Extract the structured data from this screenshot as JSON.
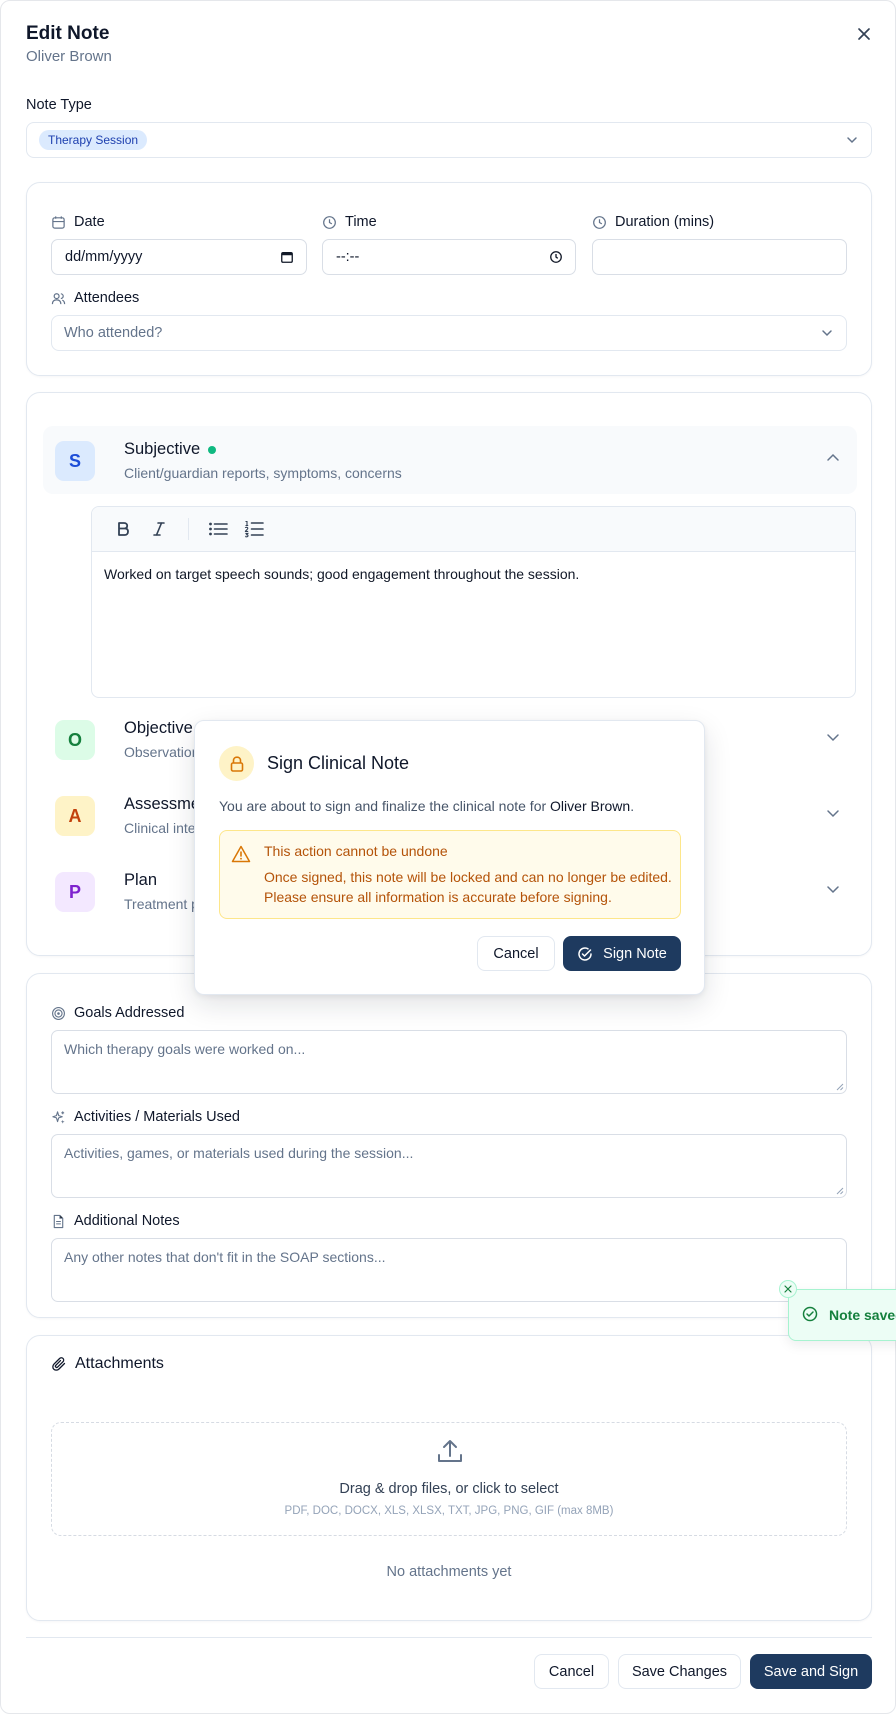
{
  "header": {
    "title": "Edit Note",
    "client_name": "Oliver Brown"
  },
  "note_type": {
    "label": "Note Type",
    "selected": "Therapy Session"
  },
  "session": {
    "date_label": "Date",
    "date_value": "dd/mm/yyyy",
    "time_label": "Time",
    "time_value": "--:--",
    "duration_label": "Duration (mins)",
    "duration_value": "",
    "attendees_label": "Attendees",
    "attendees_placeholder": "Who attended?"
  },
  "soap": {
    "subjective": {
      "letter": "S",
      "title": "Subjective",
      "subtitle": "Client/guardian reports, symptoms, concerns",
      "content": "Worked on target speech sounds; good engagement throughout the session."
    },
    "objective": {
      "letter": "O",
      "title": "Objective",
      "subtitle": "Observations,"
    },
    "assessment": {
      "letter": "A",
      "title": "Assessment",
      "subtitle": "Clinical interp"
    },
    "plan": {
      "letter": "P",
      "title": "Plan",
      "subtitle": "Treatment pla"
    }
  },
  "details": {
    "goals_label": "Goals Addressed",
    "goals_placeholder": "Which therapy goals were worked on...",
    "activities_label": "Activities / Materials Used",
    "activities_placeholder": "Activities, games, or materials used during the session...",
    "notes_label": "Additional Notes",
    "notes_placeholder": "Any other notes that don't fit in the SOAP sections..."
  },
  "attachments": {
    "title": "Attachments",
    "drop_text": "Drag & drop files, or click to select",
    "formats": "PDF, DOC, DOCX, XLS, XLSX, TXT, JPG, PNG, GIF (max 8MB)",
    "empty": "No attachments yet"
  },
  "footer": {
    "cancel": "Cancel",
    "save": "Save Changes",
    "save_sign": "Save and Sign"
  },
  "modal": {
    "title": "Sign Clinical Note",
    "desc_prefix": "You are about to sign and finalize the clinical note for",
    "client_name": "Oliver Brown",
    "desc_suffix": ".",
    "warning_title": "This action cannot be undone",
    "warning_body": "Once signed, this note will be locked and can no longer be edited. Please ensure all information is accurate before signing.",
    "cancel": "Cancel",
    "confirm": "Sign Note"
  },
  "toast": {
    "message": "Note saved"
  },
  "colors": {
    "primary": "#1e3a5f",
    "warning": "#b45309",
    "success": "#15803d"
  }
}
